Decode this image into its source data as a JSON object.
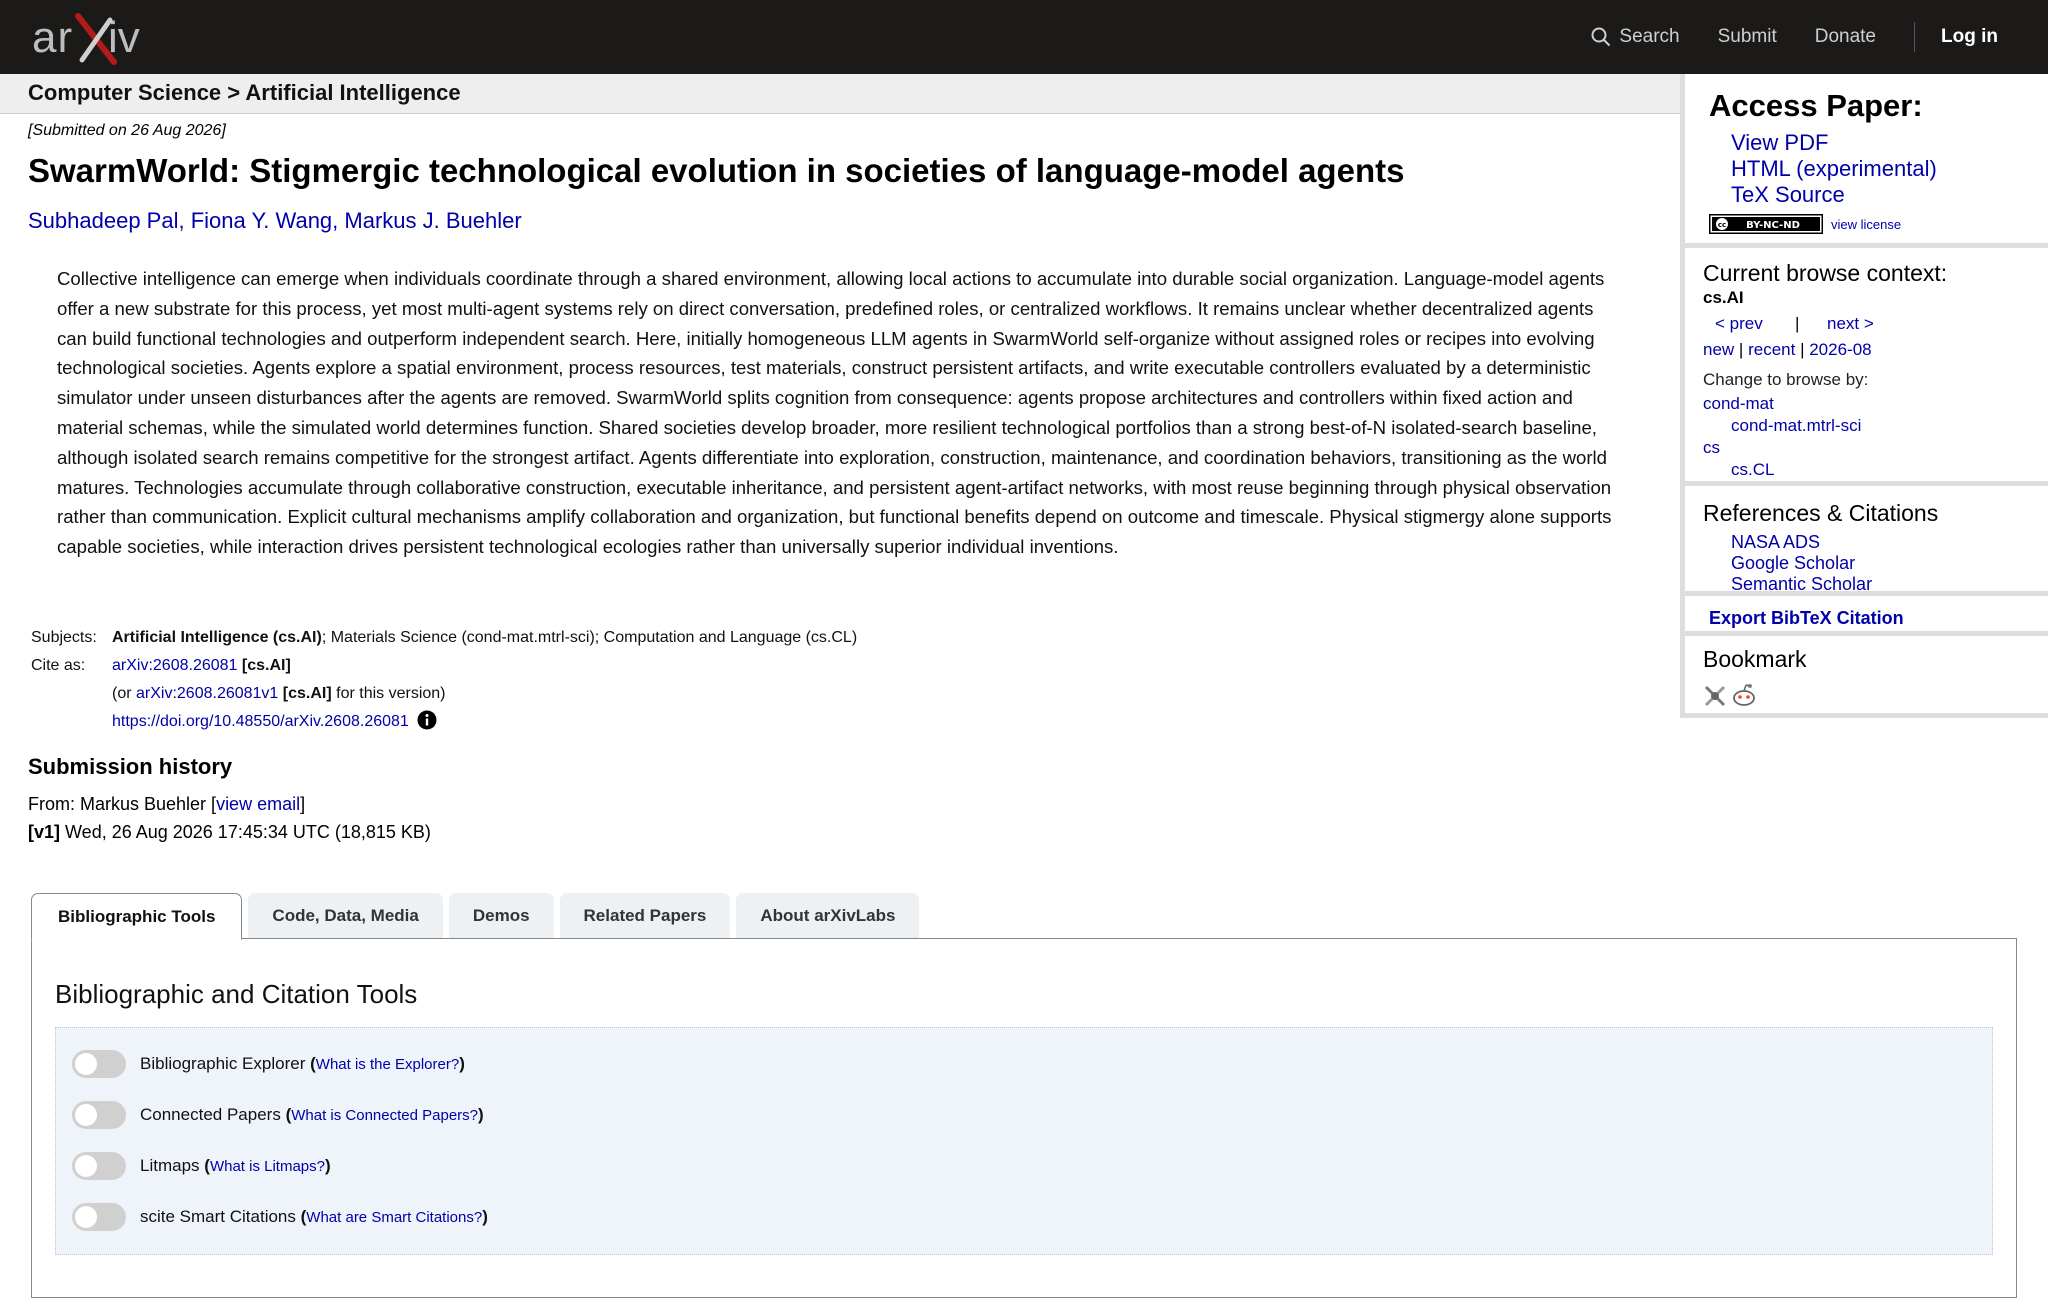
{
  "header": {
    "logo_text": "arXiv",
    "nav": {
      "search": "Search",
      "submit": "Submit",
      "donate": "Donate",
      "login": "Log in"
    }
  },
  "breadcrumb": "Computer Science > Artificial Intelligence",
  "paper": {
    "submitted": "[Submitted on 26 Aug 2026]",
    "title": "SwarmWorld: Stigmergic technological evolution in societies of language-model agents",
    "authors": [
      "Subhadeep Pal",
      "Fiona Y. Wang",
      "Markus J. Buehler"
    ],
    "author_sep": ", ",
    "abstract": "Collective intelligence can emerge when individuals coordinate through a shared environment, allowing local actions to accumulate into durable social organization. Language-model agents offer a new substrate for this process, yet most multi-agent systems rely on direct conversation, predefined roles, or centralized workflows. It remains unclear whether decentralized agents can build functional technologies and outperform independent search. Here, initially homogeneous LLM agents in SwarmWorld self-organize without assigned roles or recipes into evolving technological societies. Agents explore a spatial environment, process resources, test materials, construct persistent artifacts, and write executable controllers evaluated by a deterministic simulator under unseen disturbances after the agents are removed. SwarmWorld splits cognition from consequence: agents propose architectures and controllers within fixed action and material schemas, while the simulated world determines function. Shared societies develop broader, more resilient technological portfolios than a strong best-of-N isolated-search baseline, although isolated search remains competitive for the strongest artifact. Agents differentiate into exploration, construction, maintenance, and coordination behaviors, transitioning as the world matures. Technologies accumulate through collaborative construction, executable inheritance, and persistent agent-artifact networks, with most reuse beginning through physical observation rather than communication. Explicit cultural mechanisms amplify collaboration and organization, but functional benefits depend on outcome and timescale. Physical stigmergy alone supports capable societies, while interaction drives persistent technological ecologies rather than universally superior individual inventions.",
    "subjects_label": "Subjects:",
    "subjects_primary": "Artificial Intelligence (cs.AI)",
    "subjects_rest": "; Materials Science (cond-mat.mtrl-sci); Computation and Language (cs.CL)",
    "cite_label": "Cite as:",
    "cite_id": "arXiv:2608.26081",
    "cite_cat": "[cs.AI]",
    "cite_or": "(or ",
    "cite_v1": "arXiv:2608.26081v1",
    "cite_v1_cat": "[cs.AI]",
    "cite_v1_tail": " for this version)",
    "doi": "https://doi.org/10.48550/arXiv.2608.26081"
  },
  "submission": {
    "heading": "Submission history",
    "from_prefix": "From: Markus Buehler [",
    "view_email": "view email",
    "from_suffix": "]",
    "version": "[v1]",
    "version_detail": " Wed, 26 Aug 2026 17:45:34 UTC (18,815 KB)"
  },
  "tabs": [
    "Bibliographic Tools",
    "Code, Data, Media",
    "Demos",
    "Related Papers",
    "About arXivLabs"
  ],
  "panel": {
    "heading": "Bibliographic and Citation Tools",
    "tools": [
      {
        "name": "Bibliographic Explorer",
        "help": "What is the Explorer?"
      },
      {
        "name": "Connected Papers",
        "help": "What is Connected Papers?"
      },
      {
        "name": "Litmaps",
        "help": "What is Litmaps?"
      },
      {
        "name": "scite Smart Citations",
        "help": "What are Smart Citations?"
      }
    ]
  },
  "sidebar": {
    "access_heading": "Access Paper:",
    "view_pdf": "View PDF",
    "html": "HTML (experimental)",
    "tex": "TeX Source",
    "license_badge": "BY-NC-ND",
    "view_license": "view license",
    "context_heading": "Current browse context:",
    "context": "cs.AI",
    "prev": "< prev",
    "pipe": "|",
    "next": "next >",
    "new": "new",
    "recent": "recent",
    "month": "2026-08",
    "change_browse": "Change to browse by:",
    "browse": [
      "cond-mat",
      "cond-mat.mtrl-sci",
      "cs",
      "cs.CL"
    ],
    "refs_heading": "References & Citations",
    "refs": [
      "NASA ADS",
      "Google Scholar",
      "Semantic Scholar"
    ],
    "export": "Export BibTeX Citation",
    "bookmark": "Bookmark"
  }
}
